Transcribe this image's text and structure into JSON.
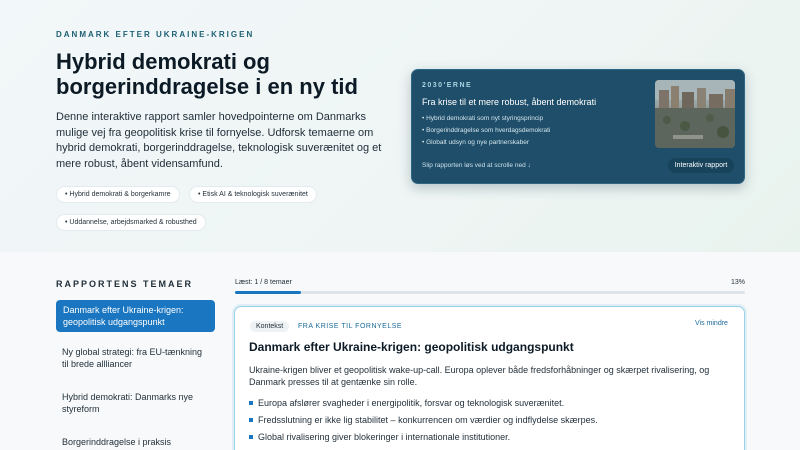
{
  "hero": {
    "eyebrow": "DANMARK EFTER UKRAINE-KRIGEN",
    "title": "Hybrid demokrati og borgerinddragelse i en ny tid",
    "lead": "Denne interaktive rapport samler hovedpointerne om Danmarks mulige vej fra geopolitisk krise til fornyelse. Udforsk temaerne om hybrid demokrati, borgerinddragelse, teknologisk suverænitet og et mere robust, åbent vidensamfund.",
    "chips": [
      "Hybrid demokrati & borgerkamre",
      "Etisk AI & teknologisk suverænitet",
      "Uddannelse, arbejdsmarked & robusthed"
    ]
  },
  "hero_card": {
    "eyebrow": "2030'ERNE",
    "title": "Fra krise til et mere robust, åbent demokrati",
    "items": [
      "Hybrid demokrati som nyt styringsprincip",
      "Borgerinddragelse som hverdagsdemokrati",
      "Globalt udsyn og nye partnerskaber"
    ],
    "footer": "Slip rapporten løs ved at scrolle ned ↓",
    "button": "Interaktiv rapport"
  },
  "toc": {
    "title": "RAPPORTENS TEMAER",
    "items": [
      "Danmark efter Ukraine-krigen: geopolitisk udgangspunkt",
      "Ny global strategi: fra EU-tænkning til brede allliancer",
      "Hybrid demokrati: Danmarks nye styreform",
      "Borgerinddragelse i praksis"
    ]
  },
  "progress": {
    "label": "Læst: 1 / 8 temaer",
    "percent_text": "13%",
    "fraction": 0.13
  },
  "section": {
    "context_tag": "Kontekst",
    "sub_tag": "FRA KRISE TIL FORNYELSE",
    "toggle": "Vis mindre",
    "title": "Danmark efter Ukraine-krigen: geopolitisk udgangspunkt",
    "text": "Ukraine-krigen bliver et geopolitisk wake-up-call. Europa oplever både fredsforhåbninger og skærpet rivalisering, og Danmark presses til at gentænke sin rolle.",
    "bullets": [
      "Europa afslører svagheder i energipolitik, forsvar og teknologisk suverænitet.",
      "Fredsslutning er ikke lig stabilitet – konkurrencen om værdier og indflydelse skærpes.",
      "Global rivalisering giver blokeringer i internationale institutioner."
    ]
  },
  "colors": {
    "accent": "#1a76c0",
    "card_bg": "#1e4e69"
  }
}
